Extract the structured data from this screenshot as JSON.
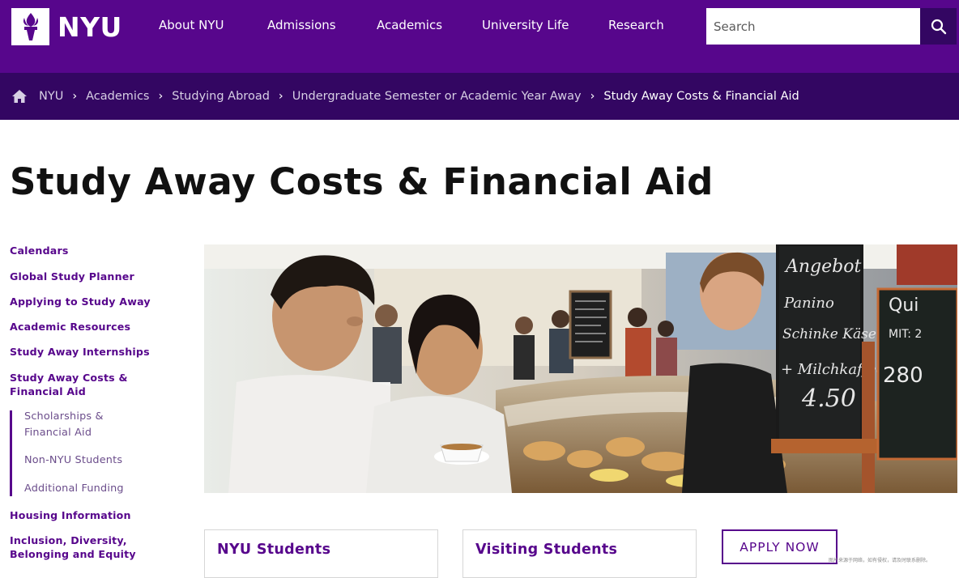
{
  "brand": {
    "logo_text": "NYU",
    "primary_color": "#57068c",
    "dark_color": "#330662"
  },
  "nav": {
    "items": [
      {
        "label": "About NYU"
      },
      {
        "label": "Admissions"
      },
      {
        "label": "Academics"
      },
      {
        "label": "University Life"
      },
      {
        "label": "Research"
      }
    ]
  },
  "search": {
    "placeholder": "Search",
    "icon": "search-icon"
  },
  "breadcrumb": {
    "home_icon": "home-icon",
    "items": [
      "NYU",
      "Academics",
      "Studying Abroad",
      "Undergraduate Semester or Academic Year Away"
    ],
    "current": "Study Away Costs & Financial Aid"
  },
  "page": {
    "title": "Study Away Costs & Financial Aid"
  },
  "sidebar": {
    "items": [
      {
        "label": "Calendars"
      },
      {
        "label": "Global Study Planner"
      },
      {
        "label": "Applying to Study Away"
      },
      {
        "label": "Academic Resources"
      },
      {
        "label": "Study Away Internships"
      },
      {
        "label_line1": "Study Away Costs &",
        "label_line2": "Financial Aid"
      },
      {
        "label": "Housing Information"
      },
      {
        "label_line1": "Inclusion, Diversity,",
        "label_line2": "Belonging and Equity"
      }
    ],
    "subitems": [
      {
        "label_line1": "Scholarships &",
        "label_line2": "Financial Aid"
      },
      {
        "label": "Non-NYU Students"
      },
      {
        "label": "Additional Funding"
      }
    ]
  },
  "cards": [
    {
      "title": "NYU Students"
    },
    {
      "title": "Visiting Students"
    }
  ],
  "cta": {
    "apply_label": "APPLY NOW"
  },
  "watermark": "图片来源于网络，如有侵权，请及时联系删除。",
  "hero": {
    "chalkboard_1": [
      "Angebot",
      "Panino",
      "Schinke Käse",
      "+ Milchkaffee",
      "4.50"
    ],
    "chalkboard_2": [
      "Qui",
      "MIT: 2",
      "280"
    ]
  }
}
